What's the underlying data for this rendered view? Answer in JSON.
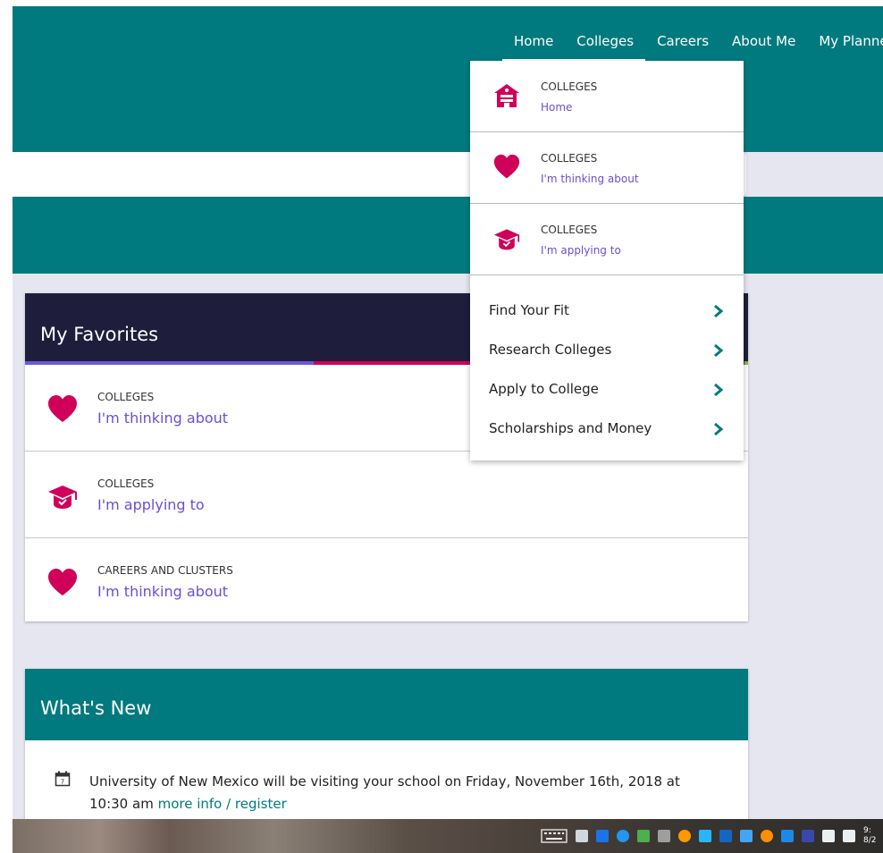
{
  "nav": {
    "items": [
      {
        "label": "Home"
      },
      {
        "label": "Colleges"
      },
      {
        "label": "Careers"
      },
      {
        "label": "About Me"
      },
      {
        "label": "My Planne"
      }
    ]
  },
  "dropdown": {
    "favorites": [
      {
        "category": "COLLEGES",
        "label": "Home",
        "icon": "school-house-icon"
      },
      {
        "category": "COLLEGES",
        "label": "I'm thinking about",
        "icon": "heart-icon"
      },
      {
        "category": "COLLEGES",
        "label": "I'm applying to",
        "icon": "graduation-cap-icon"
      }
    ],
    "links": [
      {
        "label": "Find Your Fit"
      },
      {
        "label": "Research Colleges"
      },
      {
        "label": "Apply to College"
      },
      {
        "label": "Scholarships and Money"
      }
    ]
  },
  "favorites": {
    "title": "My Favorites",
    "items": [
      {
        "category": "COLLEGES",
        "label": "I'm thinking about",
        "icon": "heart-icon"
      },
      {
        "category": "COLLEGES",
        "label": "I'm applying to",
        "icon": "graduation-cap-icon"
      },
      {
        "category": "CAREERS AND CLUSTERS",
        "label": "I'm thinking about",
        "icon": "heart-icon"
      }
    ]
  },
  "news": {
    "title": "What's New",
    "items": [
      {
        "text": "University of New Mexico will be visiting your school on Friday, November 16th, 2018 at 10:30 am ",
        "link": "more info / register",
        "icon": "calendar-icon"
      }
    ]
  },
  "taskbar": {
    "clock_time": "9:",
    "clock_date": "8/2"
  },
  "colors": {
    "teal": "#007a7e",
    "navy": "#1e1e3c",
    "magenta": "#d0005a",
    "purple_link": "#6a4fd6",
    "stripe_purple": "#6a5ad8",
    "stripe_pink": "#d0005a",
    "stripe_green": "#7bbf3a"
  }
}
